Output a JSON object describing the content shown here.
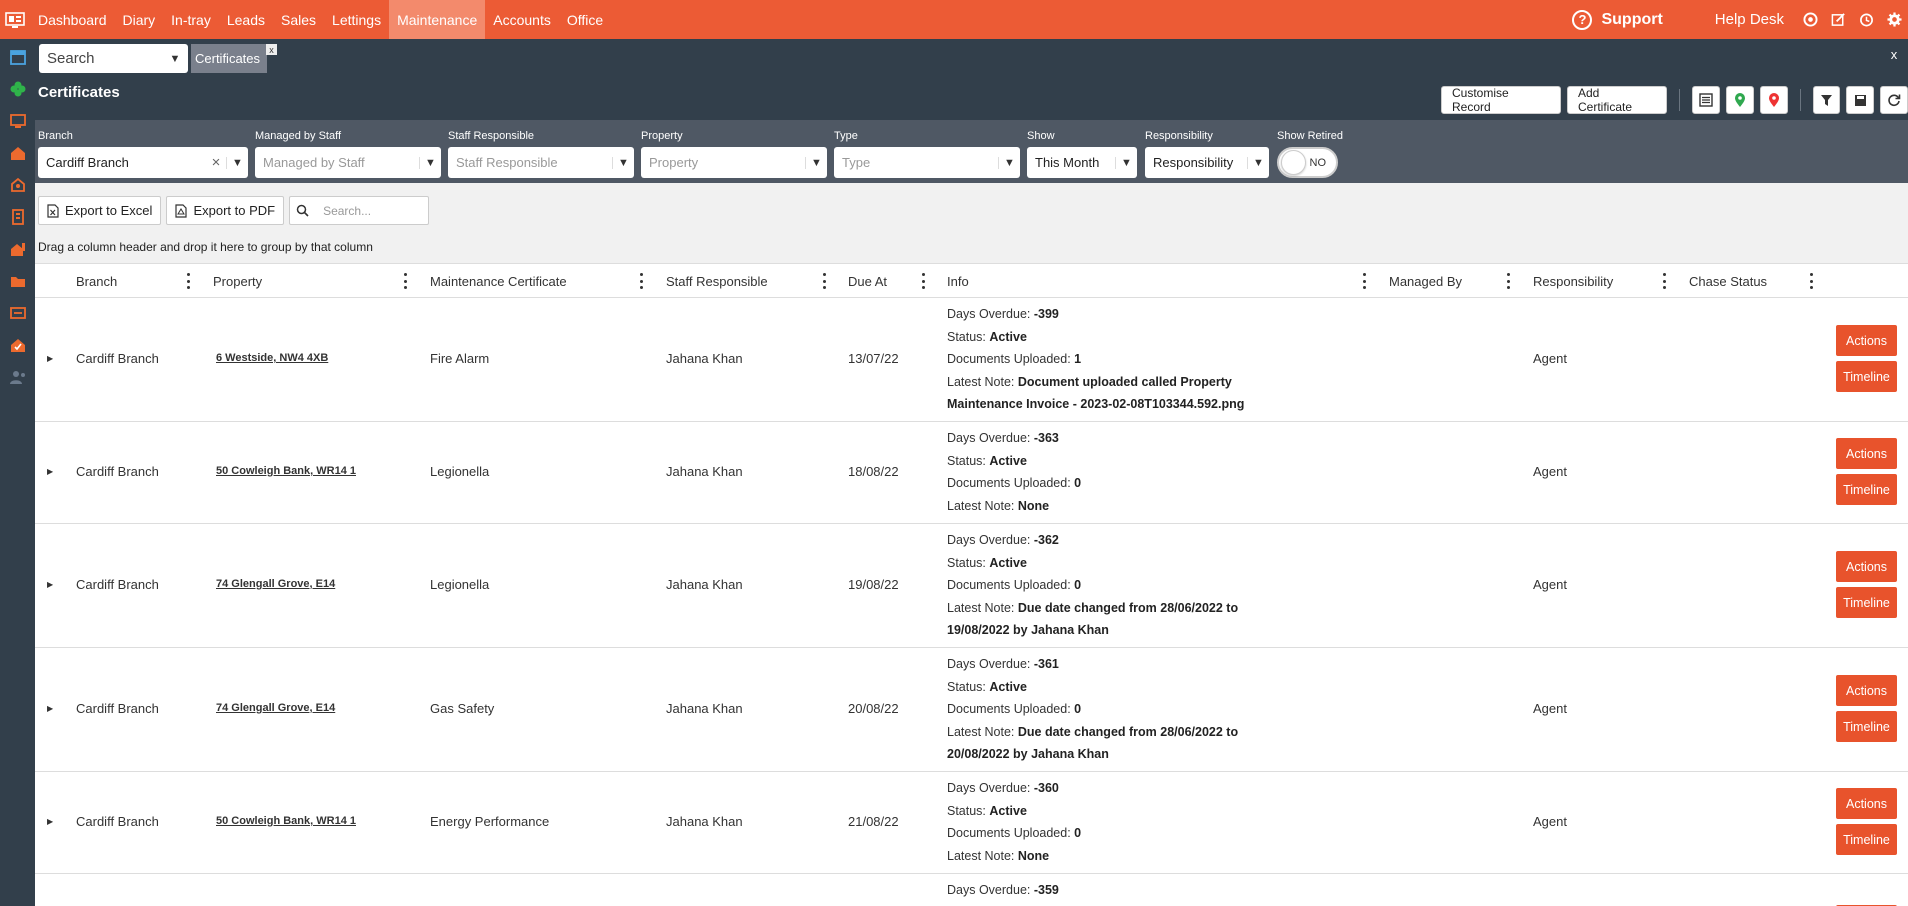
{
  "nav": {
    "items": [
      "Dashboard",
      "Diary",
      "In-tray",
      "Leads",
      "Sales",
      "Lettings",
      "Maintenance",
      "Accounts",
      "Office"
    ],
    "active": "Maintenance",
    "support_label": "Support",
    "helpdesk_label": "Help Desk"
  },
  "colors": {
    "brand": "#ec5b35",
    "dark": "#323f4b",
    "filter_bg": "#4f5864",
    "action_button": "#e8532c"
  },
  "search": {
    "value": "Search"
  },
  "open_tab": {
    "label": "Certificates",
    "close": "x"
  },
  "close_window": "x",
  "page": {
    "title": "Certificates"
  },
  "header_buttons": {
    "customise": "Customise Record",
    "add": "Add Certificate"
  },
  "filters": {
    "branch": {
      "label": "Branch",
      "value": "Cardiff Branch"
    },
    "managed_by": {
      "label": "Managed by Staff",
      "placeholder": "Managed by Staff"
    },
    "staff_responsible": {
      "label": "Staff Responsible",
      "placeholder": "Staff Responsible"
    },
    "property": {
      "label": "Property",
      "placeholder": "Property"
    },
    "type": {
      "label": "Type",
      "placeholder": "Type"
    },
    "show": {
      "label": "Show",
      "value": "This Month"
    },
    "responsibility": {
      "label": "Responsibility",
      "value": "Responsibility"
    },
    "show_retired": {
      "label": "Show Retired",
      "value": "NO"
    }
  },
  "toolbar": {
    "excel": "Export to Excel",
    "pdf": "Export to PDF",
    "search_placeholder": "Search..."
  },
  "group_hint": "Drag a column header and drop it here to group by that column",
  "columns": [
    "Branch",
    "Property",
    "Maintenance Certificate",
    "Staff Responsible",
    "Due At",
    "Info",
    "Managed By",
    "Responsibility",
    "Chase Status"
  ],
  "info_labels": {
    "overdue": "Days Overdue: ",
    "status": "Status: ",
    "docs": "Documents Uploaded: ",
    "note": "Latest Note: "
  },
  "row_buttons": {
    "actions": "Actions",
    "timeline": "Timeline"
  },
  "rows": [
    {
      "branch": "Cardiff Branch",
      "property": "6 Westside, NW4 4XB",
      "certificate": "Fire Alarm",
      "staff": "Jahana Khan",
      "due": "13/07/22",
      "overdue": "-399",
      "status": "Active",
      "docs": "1",
      "note_line1": "Document uploaded called Property",
      "note_line2": "Maintenance Invoice - 2023-02-08T103344.592.png",
      "managed_by": "",
      "responsibility": "Agent",
      "chase": ""
    },
    {
      "branch": "Cardiff Branch",
      "property": "50 Cowleigh Bank, WR14 1",
      "certificate": "Legionella",
      "staff": "Jahana Khan",
      "due": "18/08/22",
      "overdue": "-363",
      "status": "Active",
      "docs": "0",
      "note_line1": "None",
      "note_line2": "",
      "managed_by": "",
      "responsibility": "Agent",
      "chase": ""
    },
    {
      "branch": "Cardiff Branch",
      "property": "74 Glengall Grove, E14",
      "certificate": "Legionella",
      "staff": "Jahana Khan",
      "due": "19/08/22",
      "overdue": "-362",
      "status": "Active",
      "docs": "0",
      "note_line1": "Due date changed from 28/06/2022 to",
      "note_line2": "19/08/2022 by Jahana Khan",
      "managed_by": "",
      "responsibility": "Agent",
      "chase": ""
    },
    {
      "branch": "Cardiff Branch",
      "property": "74 Glengall Grove, E14",
      "certificate": "Gas Safety",
      "staff": "Jahana Khan",
      "due": "20/08/22",
      "overdue": "-361",
      "status": "Active",
      "docs": "0",
      "note_line1": "Due date changed from 28/06/2022 to",
      "note_line2": "20/08/2022 by Jahana Khan",
      "managed_by": "",
      "responsibility": "Agent",
      "chase": ""
    },
    {
      "branch": "Cardiff Branch",
      "property": "50 Cowleigh Bank, WR14 1",
      "certificate": "Energy Performance",
      "staff": "Jahana Khan",
      "due": "21/08/22",
      "overdue": "-360",
      "status": "Active",
      "docs": "0",
      "note_line1": "None",
      "note_line2": "",
      "managed_by": "",
      "responsibility": "Agent",
      "chase": ""
    },
    {
      "overdue": "-359"
    }
  ]
}
